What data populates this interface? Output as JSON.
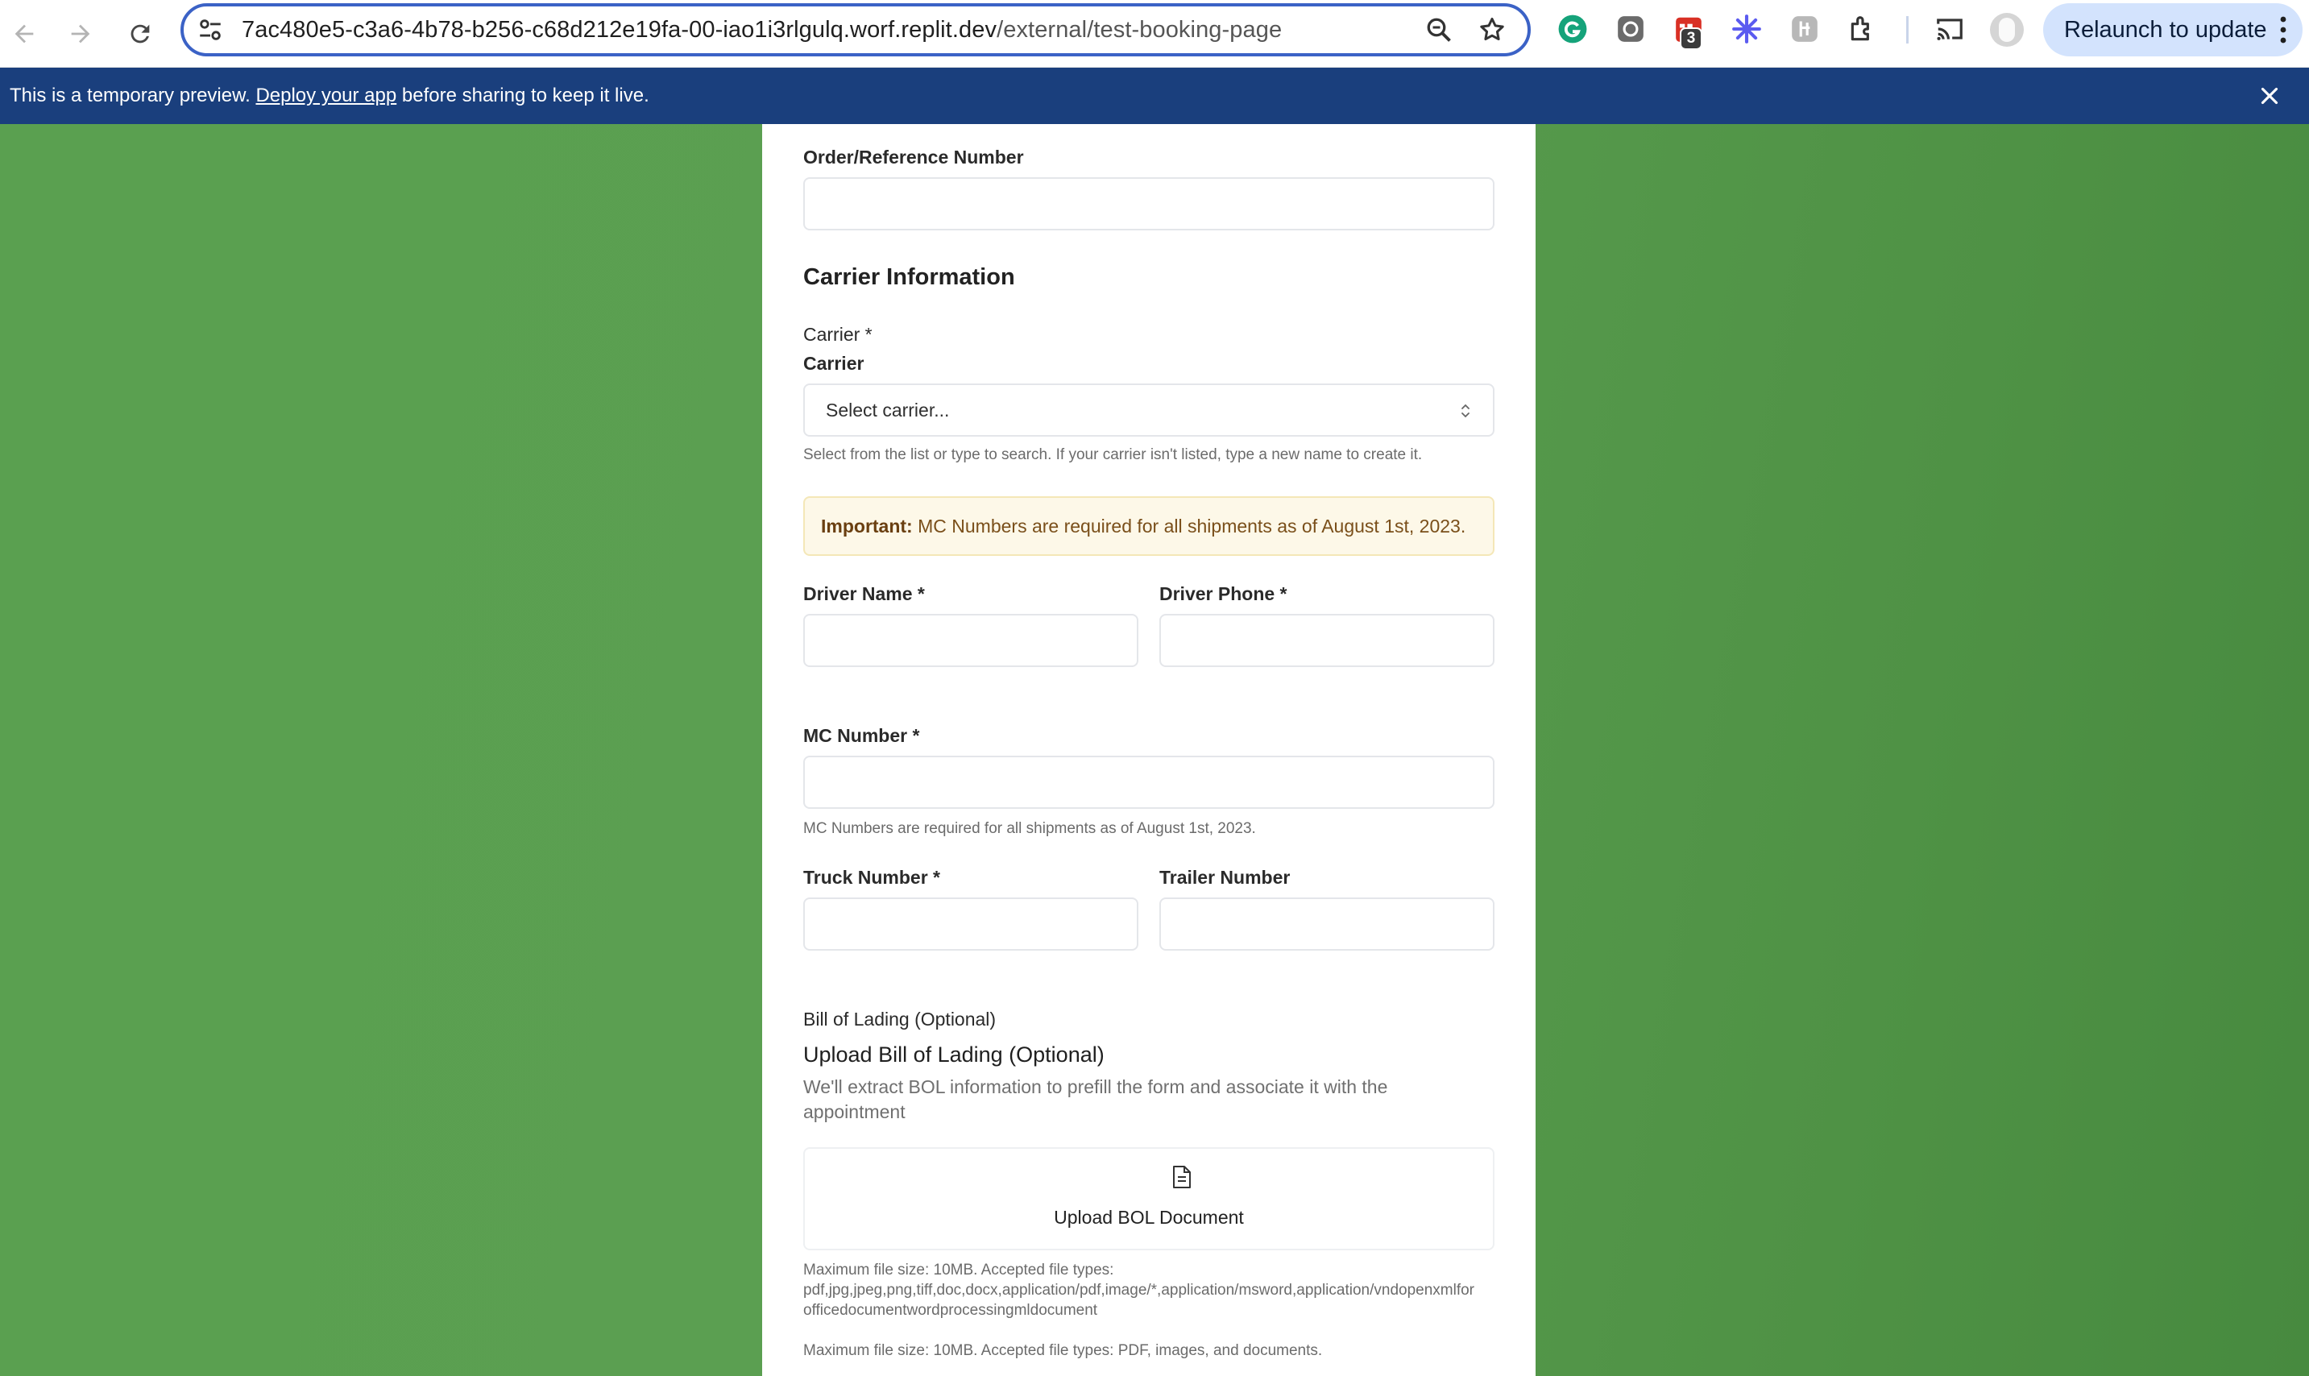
{
  "browser": {
    "url_host": "7ac480e5-c3a6-4b78-b256-c68d212e19fa-00-iao1i3rlgulq.worf.replit.dev",
    "url_path": "/external/test-booking-page",
    "extension_badge": "3",
    "relaunch_label": "Relaunch to update"
  },
  "banner": {
    "text_before": "This is a temporary preview. ",
    "link_text": "Deploy your app",
    "text_after": " before sharing to keep it live."
  },
  "form": {
    "order_ref_label": "Order/Reference Number",
    "carrier_section_title": "Carrier Information",
    "carrier_label": "Carrier *",
    "carrier_sublabel": "Carrier",
    "carrier_placeholder": "Select carrier...",
    "carrier_help": "Select from the list or type to search. If your carrier isn't listed, type a new name to create it.",
    "alert_strong": "Important:",
    "alert_text": " MC Numbers are required for all shipments as of August 1st, 2023.",
    "driver_name_label": "Driver Name *",
    "driver_phone_label": "Driver Phone *",
    "mc_number_label": "MC Number *",
    "mc_number_help": "MC Numbers are required for all shipments as of August 1st, 2023.",
    "truck_number_label": "Truck Number *",
    "trailer_number_label": "Trailer Number",
    "bol_label": "Bill of Lading (Optional)",
    "bol_title": "Upload Bill of Lading (Optional)",
    "bol_desc": "We'll extract BOL information to prefill the form and associate it with the appointment",
    "upload_button": "Upload BOL Document",
    "file_note_1": "Maximum file size: 10MB. Accepted file types:",
    "file_note_2": "pdf,jpg,jpeg,png,tiff,doc,docx,application/pdf,image/*,application/msword,application/vndopenxmlfor",
    "file_note_3": "officedocumentwordprocessingmldocument",
    "file_note_4": "Maximum file size: 10MB. Accepted file types: PDF, images, and documents."
  },
  "colors": {
    "omnibox_border": "#3b62c6",
    "banner_bg": "#1a3f7d",
    "page_bg": "#5aa050",
    "alert_bg": "#fdf8e8"
  }
}
